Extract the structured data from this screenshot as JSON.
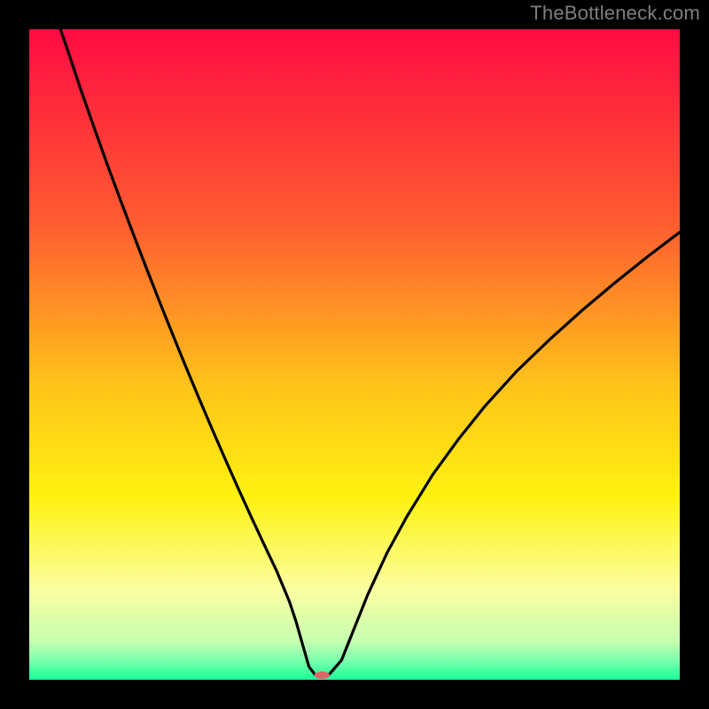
{
  "watermark": "TheBottleneck.com",
  "chart_data": {
    "type": "line",
    "title": "",
    "xlabel": "",
    "ylabel": "",
    "xlim": [
      0,
      100
    ],
    "ylim": [
      0,
      100
    ],
    "legend": false,
    "grid": false,
    "background_gradient": {
      "stops": [
        {
          "offset": 0.0,
          "color": "#ff0b42"
        },
        {
          "offset": 0.3,
          "color": "#ff5d30"
        },
        {
          "offset": 0.55,
          "color": "#ffc41a"
        },
        {
          "offset": 0.72,
          "color": "#fff210"
        },
        {
          "offset": 0.86,
          "color": "#fbffa0"
        },
        {
          "offset": 0.94,
          "color": "#c8ffb0"
        },
        {
          "offset": 0.97,
          "color": "#7dffad"
        },
        {
          "offset": 1.0,
          "color": "#18ff9a"
        }
      ]
    },
    "series": [
      {
        "name": "bottleneck-curve",
        "color": "#000000",
        "x": [
          4.8,
          6,
          8,
          10,
          12,
          14,
          16,
          18,
          20,
          22,
          24,
          26,
          28,
          30,
          32,
          34,
          36,
          38,
          40,
          41,
          42,
          43,
          44,
          46,
          48,
          50,
          52,
          55,
          58,
          62,
          66,
          70,
          75,
          80,
          85,
          90,
          95,
          100
        ],
        "y": [
          100,
          96.5,
          90.5,
          84.8,
          79.2,
          73.8,
          68.5,
          63.3,
          58.2,
          53.2,
          48.3,
          43.5,
          38.8,
          34.2,
          29.7,
          25.3,
          21.0,
          16.8,
          12.0,
          9.0,
          5.5,
          2.0,
          0.7,
          0.7,
          3.0,
          8.0,
          13.0,
          19.5,
          25.0,
          31.5,
          37.0,
          42.0,
          47.5,
          52.3,
          56.8,
          61.0,
          65.0,
          68.8
        ]
      }
    ],
    "markers": [
      {
        "name": "optimal-point",
        "shape": "pill",
        "x": 45.0,
        "y": 0.7,
        "color": "#d86a6a",
        "width_frac": 0.024,
        "height_frac": 0.012
      }
    ]
  }
}
